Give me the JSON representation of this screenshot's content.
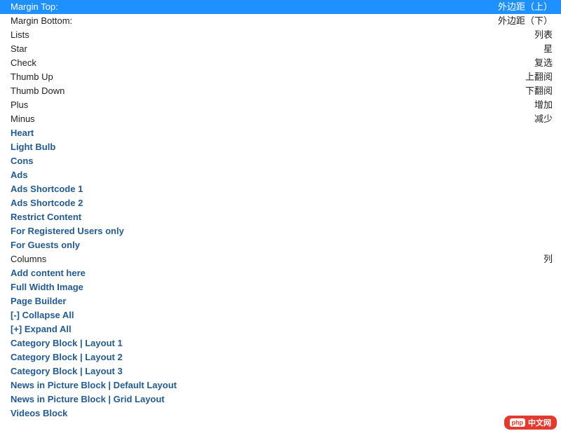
{
  "rows": [
    {
      "left": "Margin Top:",
      "right": "外边距（上）",
      "bold": false,
      "selected": true
    },
    {
      "left": "Margin Bottom:",
      "right": "外边距（下）",
      "bold": false,
      "selected": false
    },
    {
      "left": "Lists",
      "right": "列表",
      "bold": false,
      "selected": false
    },
    {
      "left": "Star",
      "right": "星",
      "bold": false,
      "selected": false
    },
    {
      "left": "Check",
      "right": "复选",
      "bold": false,
      "selected": false
    },
    {
      "left": "Thumb Up",
      "right": "上翻阅",
      "bold": false,
      "selected": false
    },
    {
      "left": "Thumb Down",
      "right": "下翻阅",
      "bold": false,
      "selected": false
    },
    {
      "left": "Plus",
      "right": "增加",
      "bold": false,
      "selected": false
    },
    {
      "left": "Minus",
      "right": "减少",
      "bold": false,
      "selected": false
    },
    {
      "left": "Heart",
      "right": "",
      "bold": true,
      "selected": false
    },
    {
      "left": "Light Bulb",
      "right": "",
      "bold": true,
      "selected": false
    },
    {
      "left": "Cons",
      "right": "",
      "bold": true,
      "selected": false
    },
    {
      "left": "Ads",
      "right": "",
      "bold": true,
      "selected": false
    },
    {
      "left": "Ads Shortcode 1",
      "right": "",
      "bold": true,
      "selected": false
    },
    {
      "left": "Ads Shortcode 2",
      "right": "",
      "bold": true,
      "selected": false
    },
    {
      "left": "Restrict Content",
      "right": "",
      "bold": true,
      "selected": false
    },
    {
      "left": "For Registered Users only",
      "right": "",
      "bold": true,
      "selected": false
    },
    {
      "left": "For Guests only",
      "right": "",
      "bold": true,
      "selected": false
    },
    {
      "left": "Columns",
      "right": "列",
      "bold": false,
      "selected": false
    },
    {
      "left": "Add content here",
      "right": "",
      "bold": true,
      "selected": false
    },
    {
      "left": "Full Width Image",
      "right": "",
      "bold": true,
      "selected": false
    },
    {
      "left": "Page Builder",
      "right": "",
      "bold": true,
      "selected": false
    },
    {
      "left": "[-] Collapse All",
      "right": "",
      "bold": true,
      "selected": false
    },
    {
      "left": "[+] Expand All",
      "right": "",
      "bold": true,
      "selected": false
    },
    {
      "left": "Category Block | Layout 1",
      "right": "",
      "bold": true,
      "selected": false
    },
    {
      "left": "Category Block | Layout 2",
      "right": "",
      "bold": true,
      "selected": false
    },
    {
      "left": "Category Block | Layout 3",
      "right": "",
      "bold": true,
      "selected": false
    },
    {
      "left": "News in Picture Block | Default Layout",
      "right": "",
      "bold": true,
      "selected": false
    },
    {
      "left": "News in Picture Block | Grid Layout",
      "right": "",
      "bold": true,
      "selected": false
    },
    {
      "left": "Videos Block",
      "right": "",
      "bold": true,
      "selected": false
    }
  ],
  "watermark": {
    "tag": "php",
    "text": "中文网"
  }
}
